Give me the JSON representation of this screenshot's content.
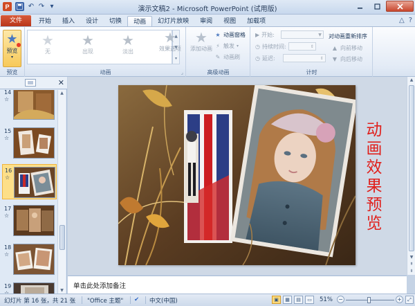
{
  "window": {
    "title": "演示文稿2 - Microsoft PowerPoint (试用版)",
    "app_badge": "P",
    "controls": [
      "minimize",
      "maximize",
      "close"
    ]
  },
  "qat": {
    "icons": [
      "powerpoint-app-icon",
      "save-icon",
      "undo-icon",
      "redo-icon",
      "qat-customize-icon"
    ]
  },
  "ribbon_tabs": {
    "file": "文件",
    "items": [
      "开始",
      "插入",
      "设计",
      "切换",
      "动画",
      "幻灯片放映",
      "审阅",
      "视图",
      "加载项"
    ],
    "active_index": 4
  },
  "ribbon": {
    "preview": {
      "button": "预览",
      "group": "预览"
    },
    "animation": {
      "group": "动画",
      "effects": [
        "无",
        "出现",
        "淡出"
      ],
      "effect_options": "效果选项"
    },
    "advanced": {
      "group": "高级动画",
      "add_animation": "添加动画",
      "pane": "动画窗格",
      "trigger": "触发",
      "painter": "动画刷"
    },
    "timing": {
      "group": "计时",
      "start_label": "开始:",
      "duration_label": "持续时间:",
      "delay_label": "延迟:",
      "reorder_label": "对动画重新排序",
      "move_earlier": "向前移动",
      "move_later": "向后移动"
    }
  },
  "slides_panel": {
    "thumbnails": [
      {
        "number": "14",
        "star": "☆",
        "selected": false
      },
      {
        "number": "15",
        "star": "☆",
        "selected": false
      },
      {
        "number": "16",
        "star": "☆",
        "selected": true
      },
      {
        "number": "17",
        "star": "☆",
        "selected": false
      },
      {
        "number": "18",
        "star": "☆",
        "selected": false
      },
      {
        "number": "19",
        "star": "☆",
        "selected": false
      }
    ]
  },
  "slide": {
    "text": "动画效果预览"
  },
  "notes": {
    "placeholder": "单击此处添加备注"
  },
  "statusbar": {
    "slide_info": "幻灯片 第 16 张，共 21 张",
    "theme": "\"Office 主题\"",
    "language": "中文(中国)",
    "zoom": "51%"
  },
  "colors": {
    "file_tab": "#c8401e",
    "slide_text": "#e0201c",
    "selected_thumb": "#fddf88"
  }
}
